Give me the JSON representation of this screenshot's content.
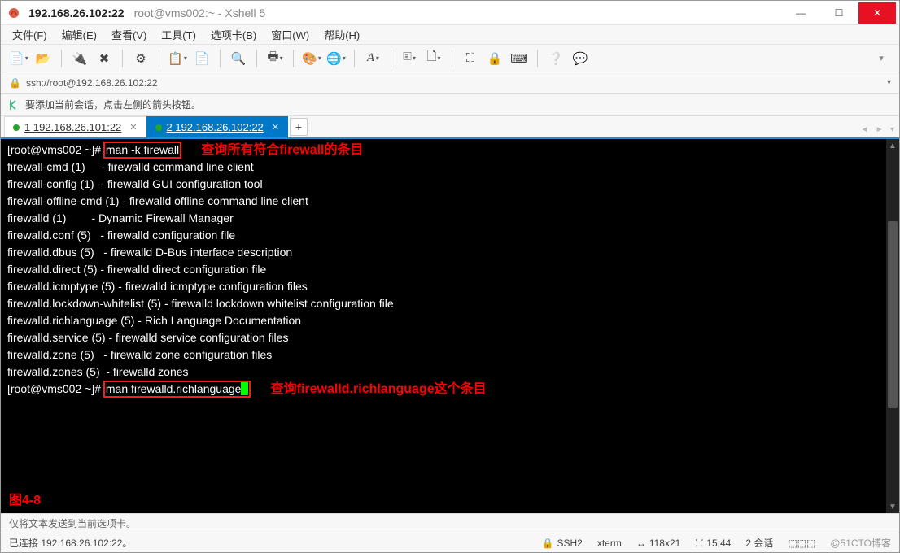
{
  "window": {
    "title_strong": "192.168.26.102:22",
    "title_rest": "root@vms002:~ - Xshell 5"
  },
  "menu": [
    "文件(F)",
    "编辑(E)",
    "查看(V)",
    "工具(T)",
    "选项卡(B)",
    "窗口(W)",
    "帮助(H)"
  ],
  "address": {
    "url": "ssh://root@192.168.26.102:22"
  },
  "hint": "要添加当前会话，点击左侧的箭头按钮。",
  "tabs": {
    "items": [
      {
        "label": "1 192.168.26.101:22",
        "active": false
      },
      {
        "label": "2 192.168.26.102:22",
        "active": true
      }
    ]
  },
  "terminal": {
    "prompt1": "[root@vms002 ~]# ",
    "cmd1": "man -k firewall",
    "anno1": "查询所有符合firewall的条目",
    "lines": [
      "firewall-cmd (1)     - firewalld command line client",
      "firewall-config (1)  - firewalld GUI configuration tool",
      "firewall-offline-cmd (1) - firewalld offline command line client",
      "firewalld (1)        - Dynamic Firewall Manager",
      "firewalld.conf (5)   - firewalld configuration file",
      "firewalld.dbus (5)   - firewalld D-Bus interface description",
      "firewalld.direct (5) - firewalld direct configuration file",
      "firewalld.icmptype (5) - firewalld icmptype configuration files",
      "firewalld.lockdown-whitelist (5) - firewalld lockdown whitelist configuration file",
      "firewalld.richlanguage (5) - Rich Language Documentation",
      "firewalld.service (5) - firewalld service configuration files",
      "firewalld.zone (5)   - firewalld zone configuration files",
      "firewalld.zones (5)  - firewalld zones"
    ],
    "prompt2": "[root@vms002 ~]# ",
    "cmd2": "man firewalld.richlanguage",
    "anno2": "查询firewalld.richlanguage这个条目",
    "figure": "图4-8"
  },
  "infobar": "仅将文本发送到当前选项卡。",
  "status": {
    "conn": "已连接 192.168.26.102:22。",
    "ssh": "SSH2",
    "term": "xterm",
    "size": "118x21",
    "pos": "15,44",
    "sess": "2 会话",
    "watermark": "@51CTO博客"
  }
}
